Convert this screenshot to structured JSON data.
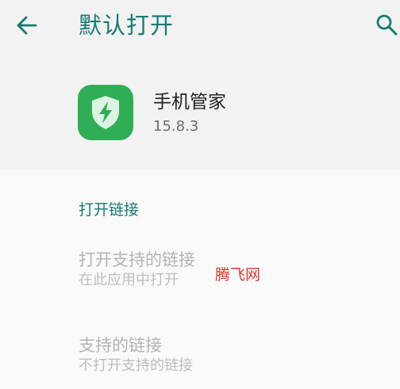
{
  "app_bar": {
    "title": "默认打开",
    "back_icon": "arrow-left-icon",
    "search_icon": "search-icon",
    "accent_color": "#137b70"
  },
  "app_info": {
    "name": "手机管家",
    "version": "15.8.3",
    "icon": "shield-bolt-icon",
    "icon_color": "#2fae55"
  },
  "section": {
    "header": "打开链接"
  },
  "items": [
    {
      "title": "打开支持的链接",
      "summary": "在此应用中打开"
    },
    {
      "title": "支持的链接",
      "summary": "不打开支持的链接"
    }
  ],
  "watermark": "腾飞网"
}
